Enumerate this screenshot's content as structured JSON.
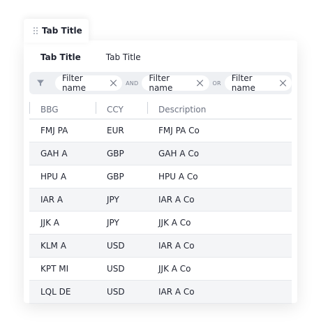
{
  "outer_tab": {
    "title": "Tab Title"
  },
  "inner_tabs": [
    {
      "label": "Tab Title",
      "active": true
    },
    {
      "label": "Tab Title",
      "active": false
    }
  ],
  "filters": {
    "chips": [
      "Filter name",
      "Filter name",
      "Filter name"
    ],
    "operators": [
      "AND",
      "OR"
    ]
  },
  "table": {
    "columns": [
      "BBG",
      "CCY",
      "Description"
    ],
    "rows": [
      [
        "FMJ PA",
        "EUR",
        "FMJ PA Co"
      ],
      [
        "GAH A",
        "GBP",
        "GAH A Co"
      ],
      [
        "HPU A",
        "GBP",
        "HPU A Co"
      ],
      [
        "IAR A",
        "JPY",
        "IAR A Co"
      ],
      [
        "JJK A",
        "JPY",
        "JJK A Co"
      ],
      [
        "KLM A",
        "USD",
        "IAR A Co"
      ],
      [
        "KPT MI",
        "USD",
        "JJK A Co"
      ],
      [
        "LQL DE",
        "USD",
        "IAR A Co"
      ]
    ]
  },
  "colors": {
    "filter_bar": "#eef0f3",
    "alt_row": "#f4f5f7",
    "text": "#1f2330",
    "muted": "#6b7180"
  }
}
